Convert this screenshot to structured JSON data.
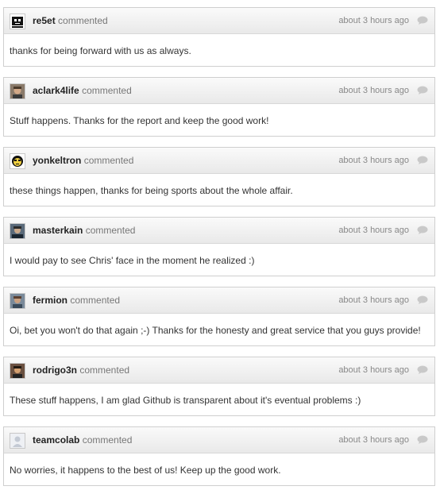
{
  "comments": [
    {
      "author": "re5et",
      "verb": "commented",
      "time": "about 3 hours ago",
      "body": "thanks for being forward with us as always.",
      "avatar_icon": "robot-avatar-icon"
    },
    {
      "author": "aclark4life",
      "verb": "commented",
      "time": "about 3 hours ago",
      "body": "Stuff happens. Thanks for the report and keep the good work!",
      "avatar_icon": "user-photo-avatar-icon"
    },
    {
      "author": "yonkeltron",
      "verb": "commented",
      "time": "about 3 hours ago",
      "body": "these things happen, thanks for being sports about the whole affair.",
      "avatar_icon": "face-avatar-icon"
    },
    {
      "author": "masterkain",
      "verb": "commented",
      "time": "about 3 hours ago",
      "body": "I would pay to see Chris' face in the moment he realized :)",
      "avatar_icon": "user-photo-avatar-icon"
    },
    {
      "author": "fermion",
      "verb": "commented",
      "time": "about 3 hours ago",
      "body": "Oi, bet you won't do that again ;-) Thanks for the honesty and great service that you guys provide!",
      "avatar_icon": "user-photo-avatar-icon"
    },
    {
      "author": "rodrigo3n",
      "verb": "commented",
      "time": "about 3 hours ago",
      "body": "These stuff happens, I am glad Github is transparent about it's eventual problems :)",
      "avatar_icon": "user-photo-avatar-icon"
    },
    {
      "author": "teamcolab",
      "verb": "commented",
      "time": "about 3 hours ago",
      "body": "No worries, it happens to the best of us! Keep up the good work.",
      "avatar_icon": "default-avatar-icon"
    }
  ]
}
